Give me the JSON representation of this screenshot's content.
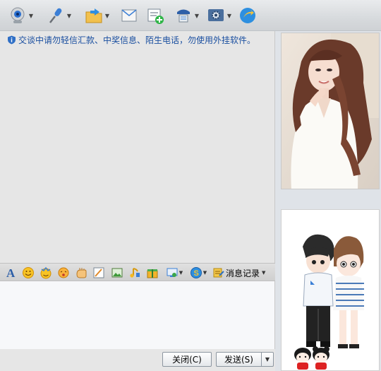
{
  "notice": {
    "text": "交谈中请勿轻信汇款、中奖信息、陌生电话，勿使用外挂软件。"
  },
  "toolbar": {
    "items": [
      {
        "icon": "webcam-icon"
      },
      {
        "icon": "microphone-icon"
      },
      {
        "icon": "file-transfer-icon"
      },
      {
        "icon": "mail-icon"
      },
      {
        "icon": "add-app-icon"
      },
      {
        "icon": "remote-assist-icon"
      },
      {
        "icon": "settings-icon"
      },
      {
        "icon": "share-icon"
      }
    ]
  },
  "format_bar": {
    "icons": [
      "font-icon",
      "emoticon-icon",
      "magic-emoticon-icon",
      "shake-icon",
      "nudge-icon",
      "scribble-icon",
      "screenshot-icon",
      "music-icon",
      "gift-icon",
      "more-icon",
      "soso-icon"
    ],
    "history_label": "消息记录"
  },
  "buttons": {
    "close_label": "关闭(C)",
    "send_label": "发送(S)"
  },
  "colors": {
    "notice_text": "#1a4fa0",
    "chat_bg": "#e6e6e6",
    "input_bg": "#f7f8fa"
  }
}
